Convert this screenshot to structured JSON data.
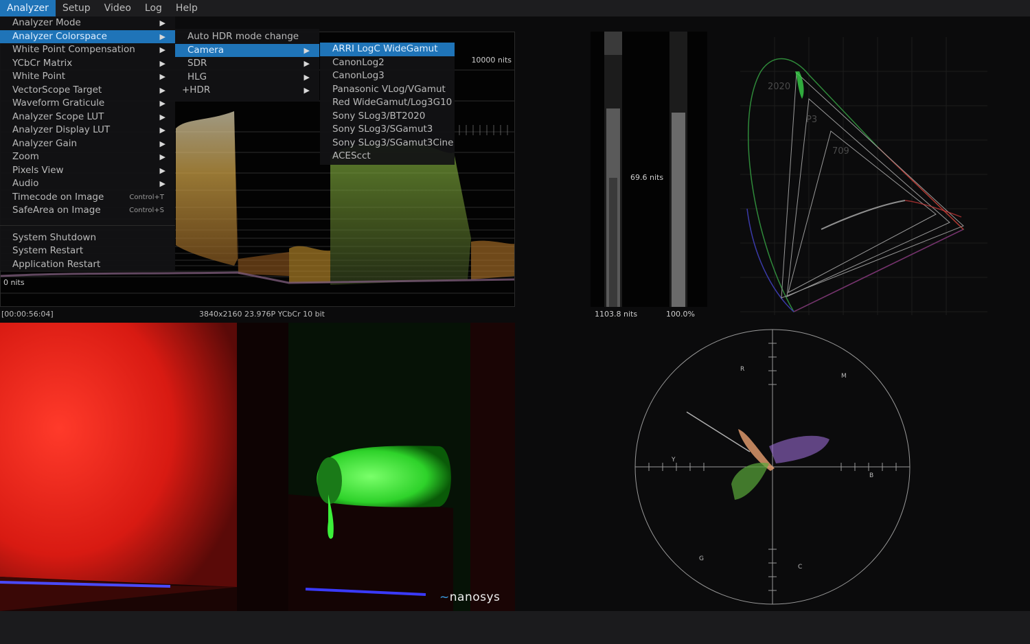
{
  "menubar": {
    "items": [
      {
        "label": "Analyzer"
      },
      {
        "label": "Setup"
      },
      {
        "label": "Video"
      },
      {
        "label": "Log"
      },
      {
        "label": "Help"
      }
    ]
  },
  "main_menu": {
    "items": [
      {
        "label": "Analyzer Mode"
      },
      {
        "label": "Analyzer Colorspace"
      },
      {
        "label": "White Point Compensation"
      },
      {
        "label": "YCbCr Matrix"
      },
      {
        "label": "White Point"
      },
      {
        "label": "VectorScope Target"
      },
      {
        "label": "Waveform Graticule"
      },
      {
        "label": "Analyzer Scope LUT"
      },
      {
        "label": "Analyzer Display LUT"
      },
      {
        "label": "Analyzer Gain"
      },
      {
        "label": "Zoom"
      },
      {
        "label": "Pixels View"
      },
      {
        "label": "Audio"
      },
      {
        "label": "Timecode on Image",
        "shortcut": "Control+T"
      },
      {
        "label": "SafeArea on Image",
        "shortcut": "Control+S"
      }
    ],
    "system_items": [
      {
        "label": "System Shutdown"
      },
      {
        "label": "System Restart"
      },
      {
        "label": "Application Restart"
      }
    ]
  },
  "colorspace_menu": {
    "items": [
      {
        "label": "Auto HDR mode change"
      },
      {
        "label": "Camera"
      },
      {
        "label": "SDR"
      },
      {
        "label": "HLG"
      },
      {
        "label": "+HDR"
      }
    ]
  },
  "camera_menu": {
    "items": [
      {
        "label": "ARRI LogC WideGamut"
      },
      {
        "label": "CanonLog2"
      },
      {
        "label": "CanonLog3"
      },
      {
        "label": "Panasonic VLog/VGamut"
      },
      {
        "label": "Red WideGamut/Log3G10"
      },
      {
        "label": "Sony SLog3/BT2020"
      },
      {
        "label": "Sony SLog3/SGamut3"
      },
      {
        "label": "Sony SLog3/SGamut3Cine"
      },
      {
        "label": "ACEScct"
      }
    ]
  },
  "waveform": {
    "top_label": "10000 nits",
    "bottom_label": "0 nits"
  },
  "status": {
    "timecode": "[00:00:56:04]",
    "format": "3840x2160 23.976P YCbCr 10 bit"
  },
  "meters": {
    "mid_label": "69.6 nits",
    "left_value": "1103.8 nits",
    "right_value": "100.0%",
    "left_level": 0.11,
    "right_level": 1.0
  },
  "cie": {
    "labels": [
      "2020",
      "P3",
      "709"
    ]
  },
  "vectorscope": {
    "targets": [
      "R",
      "M",
      "Y",
      "B",
      "G",
      "C"
    ]
  },
  "branding": {
    "logo_text": "nanosys"
  },
  "colors": {
    "accent": "#1f74b8",
    "menu_bg": "#121214",
    "image_red": "#e0221a",
    "image_green": "#3cf03a"
  }
}
